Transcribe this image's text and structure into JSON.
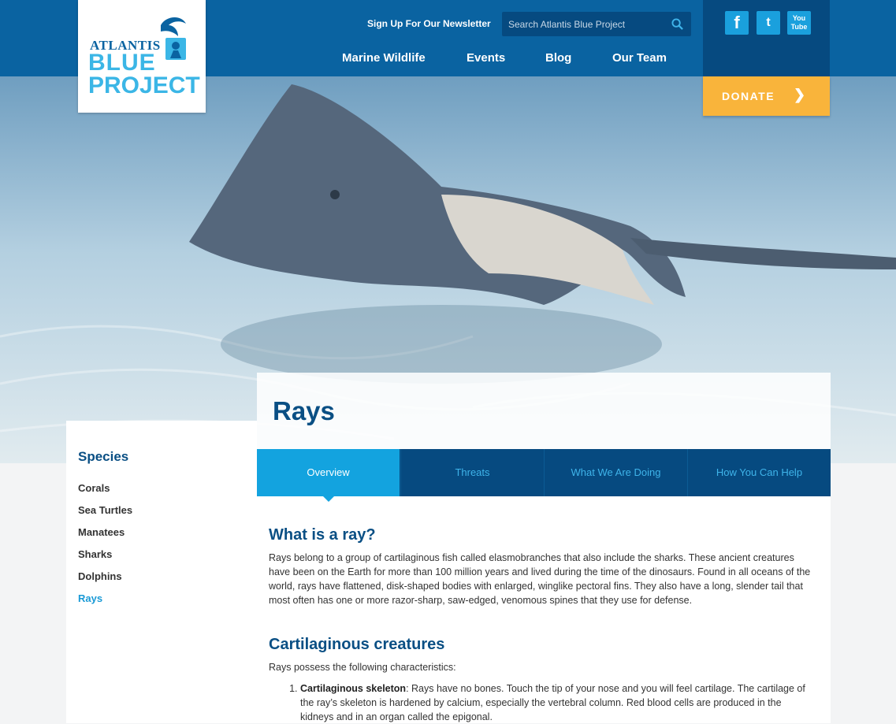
{
  "header": {
    "newsletter_label": "Sign Up For Our Newsletter",
    "search_placeholder": "Search Atlantis Blue Project",
    "nav": [
      "Marine Wildlife",
      "Events",
      "Blog",
      "Our Team"
    ],
    "social": {
      "facebook": "f",
      "twitter": "t",
      "youtube": "You Tube"
    },
    "donate_label": "DONATE"
  },
  "logo": {
    "line1": "ATLANTIS",
    "line2": "BLUE",
    "line3": "PROJECT"
  },
  "colors": {
    "brand_blue": "#0a63a1",
    "accent_orange": "#f9b43b",
    "active_tab": "#13a3df",
    "dark_nav": "#064a80"
  },
  "sidebar": {
    "heading": "Species",
    "items": [
      "Corals",
      "Sea Turtles",
      "Manatees",
      "Sharks",
      "Dolphins",
      "Rays"
    ],
    "active_index": 5
  },
  "page": {
    "title": "Rays",
    "tabs": [
      "Overview",
      "Threats",
      "What We Are Doing",
      "How You Can Help"
    ],
    "active_tab": 0
  },
  "content": {
    "h1": "What is a ray?",
    "p1": "Rays belong to a group of cartilaginous fish called elasmobranches that also include the sharks. These ancient creatures have been on the Earth for more than 100 million years and lived during the time of the dinosaurs. Found in all oceans of the world, rays have flattened, disk-shaped bodies with enlarged, winglike pectoral fins. They also have a long, slender tail that most often has one or more razor-sharp, saw-edged, venomous spines that they use for defense.",
    "h2": "Cartilaginous creatures",
    "p2": "Rays possess the following characteristics:",
    "list": [
      {
        "term": "Cartilaginous skeleton",
        "text": ": Rays have no bones. Touch the tip of your nose and you will feel cartilage. The cartilage of the ray’s skeleton is hardened by calcium, especially the vertebral column. Red blood cells are produced in the kidneys and in an organ called the epigonal."
      }
    ]
  }
}
